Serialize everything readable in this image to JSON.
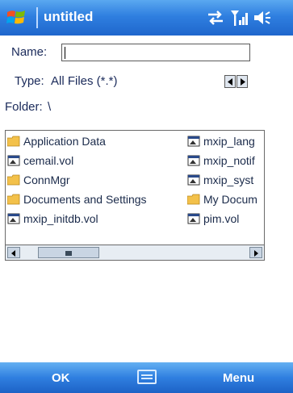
{
  "title_bar": {
    "title": "untitled",
    "icons": [
      "windows-start-flag-icon",
      "connectivity-icon",
      "signal-strength-icon",
      "speaker-volume-icon"
    ],
    "color": "#2f7fe0"
  },
  "form": {
    "name_label": "Name:",
    "name_value": "",
    "type_label": "Type:",
    "type_value": "All Files (*.*)",
    "folder_label": "Folder:",
    "folder_value": "\\"
  },
  "file_list": {
    "items": [
      {
        "name": "Application Data",
        "icon": "folder-icon"
      },
      {
        "name": "cemail.vol",
        "icon": "file-icon"
      },
      {
        "name": "ConnMgr",
        "icon": "folder-icon"
      },
      {
        "name": "Documents and Settings",
        "icon": "folder-icon"
      },
      {
        "name": "mxip_initdb.vol",
        "icon": "file-icon"
      },
      {
        "name": "mxip_lang",
        "icon": "file-icon"
      },
      {
        "name": "mxip_notif",
        "icon": "file-icon"
      },
      {
        "name": "mxip_syst",
        "icon": "file-icon"
      },
      {
        "name": "My Docum",
        "icon": "folder-icon"
      },
      {
        "name": "pim.vol",
        "icon": "file-icon"
      }
    ]
  },
  "menu_bar": {
    "left_softkey": "OK",
    "right_softkey": "Menu",
    "center_icon": "keyboard-icon"
  }
}
